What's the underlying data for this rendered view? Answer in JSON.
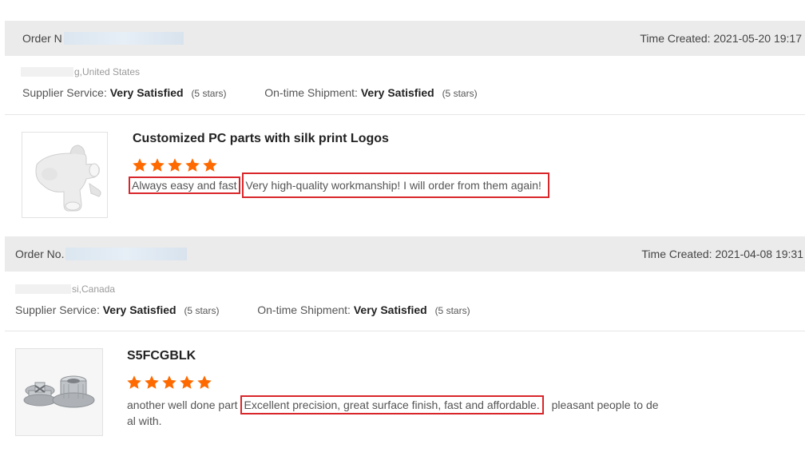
{
  "reviews": [
    {
      "order_label": "Order N",
      "time_created": "Time Created: 2021-05-20 19:17",
      "buyer_location": "g,United States",
      "supplier_service_label": "Supplier Service:",
      "supplier_service_value": "Very Satisfied",
      "supplier_service_stars": "(5 stars)",
      "shipment_label": "On-time Shipment:",
      "shipment_value": "Very Satisfied",
      "shipment_stars": "(5 stars)",
      "product_title": "Customized PC parts with silk print Logos",
      "rating": 5,
      "text_part1": "Always easy and fast",
      "text_part2": "Very high-quality workmanship! I will order from them again!",
      "thumbnail_icon": "white-plastic-part-image"
    },
    {
      "order_label": "Order No.",
      "time_created": "Time Created: 2021-04-08 19:31",
      "buyer_location": "si,Canada",
      "supplier_service_label": "Supplier Service:",
      "supplier_service_value": "Very Satisfied",
      "supplier_service_stars": "(5 stars)",
      "shipment_label": "On-time Shipment:",
      "shipment_value": "Very Satisfied",
      "shipment_stars": "(5 stars)",
      "product_title": "S5FCGBLK",
      "rating": 5,
      "text_part1": "another well done part",
      "text_part2": "Excellent precision, great surface finish, fast and affordable.",
      "text_part3": "pleasant people to de",
      "text_part4": "al with.",
      "thumbnail_icon": "metal-flange-parts-image"
    }
  ],
  "colors": {
    "star": "#ff6a00",
    "highlight_border": "#d9262b",
    "header_bg": "#ebebeb"
  }
}
